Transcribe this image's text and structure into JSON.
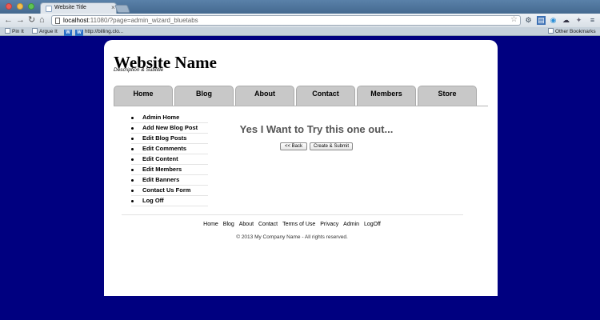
{
  "browser": {
    "tab_title": "Website Title",
    "url_host": "localhost",
    "url_rest": ":11080/?page=admin_wizard_bluetabs",
    "bookmarks": [
      "Pin It",
      "Argue It",
      "http://billing.clo..."
    ],
    "other_bookmarks": "Other Bookmarks"
  },
  "site": {
    "title": "Website Name",
    "subtitle": "Description & Subtitle"
  },
  "nav_tabs": [
    "Home",
    "Blog",
    "About",
    "Contact",
    "Members",
    "Store"
  ],
  "admin_menu": [
    "Admin Home",
    "Add New Blog Post",
    "Edit Blog Posts",
    "Edit Comments",
    "Edit Content",
    "Edit Members",
    "Edit Banners",
    "Contact Us Form",
    "Log Off"
  ],
  "main": {
    "heading": "Yes I Want to Try this one out...",
    "back_button": "<< Back",
    "submit_button": "Create & Submit"
  },
  "footer": {
    "links": [
      "Home",
      "Blog",
      "About",
      "Contact",
      "Terms of Use",
      "Privacy",
      "Admin",
      "LogOff"
    ],
    "copyright": "© 2013 My Company Name - All rights reserved."
  }
}
